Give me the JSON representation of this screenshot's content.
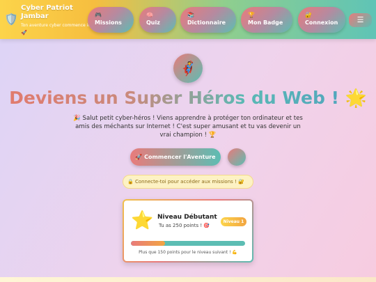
{
  "brand": {
    "title": "Cyber Patriot Jambar",
    "subtitle": "Ton aventure cyber commence ici !",
    "rocket": "🚀",
    "shield": "🛡️"
  },
  "nav": {
    "missions": {
      "icon": "🎮",
      "label": "Missions"
    },
    "quiz": {
      "icon": "🧠",
      "label": "Quiz"
    },
    "dictionary": {
      "icon": "📚",
      "label": "Dictionnaire"
    },
    "badge": {
      "icon": "🏆",
      "label": "Mon Badge"
    },
    "login": {
      "icon": "🔐",
      "label": "Connexion"
    },
    "menu_icon": "☰"
  },
  "hero": {
    "avatar": "🦸",
    "title": "Deviens un Super Héros du Web !",
    "title_star": "🌟",
    "text": "🎉 Salut petit cyber-héros ! Viens apprendre à protéger ton ordinateur et tes amis des méchants sur Internet ! C'est super amusant et tu vas devenir un vrai champion ! 🏆",
    "cta": "🚀 Commencer l'Aventure"
  },
  "notice": "🔒 Connecte-toi pour accéder aux missions ! 🔐",
  "level": {
    "star": "⭐",
    "title": "Niveau Débutant",
    "points": "Tu as 250 points ! 🎯",
    "badge": "Niveau 1",
    "progress": 0.3,
    "hint": "Plus que 150 points pour le niveau suivant ! 💪"
  },
  "colors": {
    "accent_coral": "#e97b7b",
    "accent_teal": "#5cbdb3",
    "accent_yellow": "#fcd44a"
  }
}
